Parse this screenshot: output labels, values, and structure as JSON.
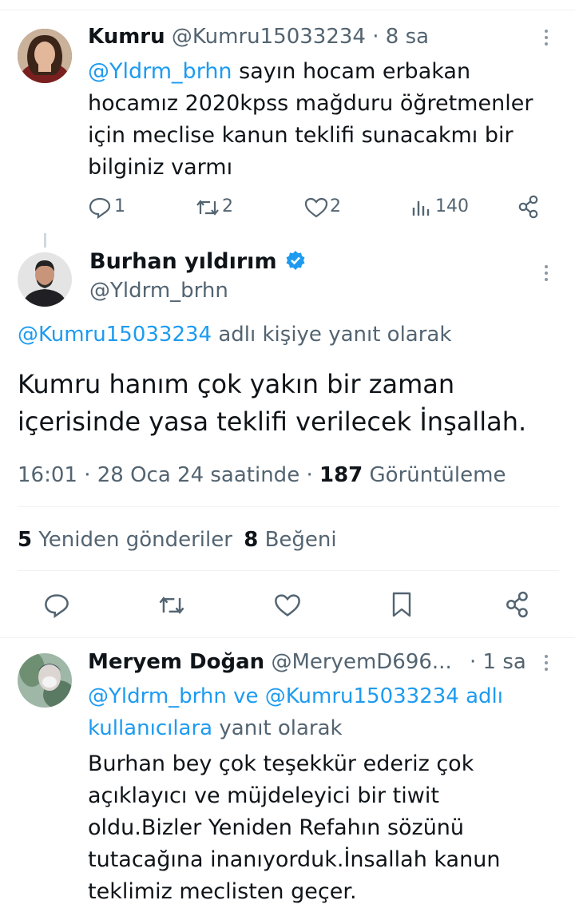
{
  "tweet1": {
    "author_name": "Kumru",
    "author_handle": "@Kumru15033234",
    "time": "· 8 sa",
    "mention": "@Yldrm_brhn",
    "text_line1": "sayın hocam erbakan",
    "text_line2": "hocamız 2020kpss mağduru öğretmenler",
    "text_line3": "için meclise kanun teklifi sunacakmı bir",
    "text_line4": "bilginiz varmı",
    "replies": "1",
    "retweets": "2",
    "likes": "2",
    "views": "140"
  },
  "main_tweet": {
    "author_name": "Burhan yıldırım",
    "author_handle": "@Yldrm_brhn",
    "reply_to_handle": "@Kumru15033234",
    "reply_to_suffix": "adlı kişiye yanıt olarak",
    "text_line1": "Kumru hanım çok yakın bir zaman",
    "text_line2": "içerisinde yasa teklifi verilecek İnşallah.",
    "meta_time": "16:01 · 28 Oca 24 saatinde ·",
    "meta_views_count": "187",
    "meta_views_label": "Görüntüleme",
    "retweet_count": "5",
    "retweet_label": "Yeniden gönderiler",
    "like_count": "8",
    "like_label": "Beğeni"
  },
  "tweet3": {
    "author_name": "Meryem Doğan",
    "author_handle": "@MeryemD696...",
    "time": "· 1 sa",
    "reply_mention1": "@Yldrm_brhn ve @Kumru15033234 adlı",
    "reply_mention2": "kullanıcılara",
    "reply_suffix": "yanıt olarak",
    "text_line1": "Burhan bey çok teşekkür ederiz çok",
    "text_line2": "açıklayıcı ve müjdeleyici  bir tiwit",
    "text_line3": "oldu.Bizler  Yeniden Refahın sözünü",
    "text_line4": "tutacağına inanıyorduk.İnsallah  kanun",
    "text_line5": "teklimiz meclisten geçer."
  },
  "icons": {
    "reply": "reply-icon",
    "retweet": "retweet-icon",
    "like": "heart-icon",
    "views": "views-icon",
    "share": "share-icon",
    "bookmark": "bookmark-icon",
    "verified": "verified-badge-icon",
    "more": "more-vertical-icon"
  },
  "colors": {
    "link": "#1d9bf0",
    "text": "#0f1419",
    "muted": "#536471"
  }
}
